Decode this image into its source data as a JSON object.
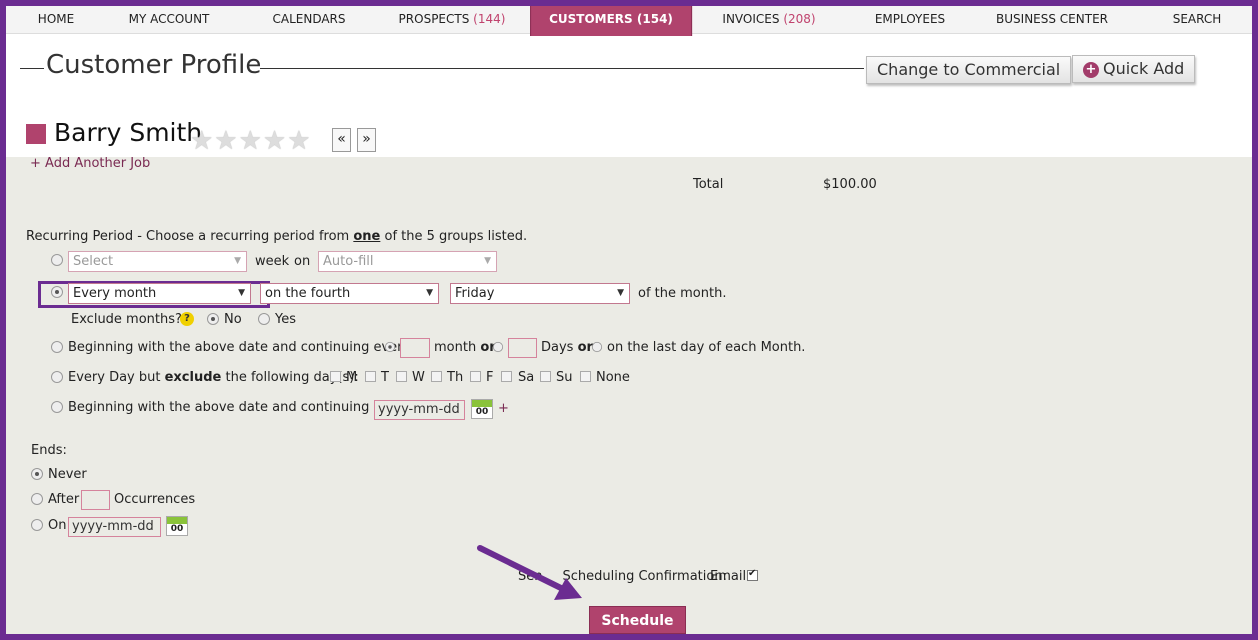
{
  "nav": {
    "home": "HOME",
    "my_account": "MY ACCOUNT",
    "calendars": "CALENDARS",
    "prospects": "PROSPECTS",
    "prospects_count": "(144)",
    "customers": "CUSTOMERS",
    "customers_count": "(154)",
    "invoices": "INVOICES",
    "invoices_count": "(208)",
    "employees": "EMPLOYEES",
    "business_center": "BUSINESS CENTER",
    "search": "SEARCH"
  },
  "header": {
    "title": "Customer Profile",
    "change_commercial": "Change to Commercial",
    "quick_add": "Quick Add"
  },
  "customer": {
    "name": "Barry Smith",
    "rating_stars": "★★★★★",
    "prev": "«",
    "next": "»"
  },
  "job": {
    "add_job": "+ Add Another Job",
    "total_label": "Total",
    "total_value": "$100.00"
  },
  "recurring": {
    "heading_bold": "Recurring Period",
    "heading_rest_a": " - Choose a recurring period from ",
    "heading_one": "one",
    "heading_rest_b": " of the 5 groups listed.",
    "row1": {
      "select": "Select",
      "week": "week",
      "on": "on",
      "autofill": "Auto-fill"
    },
    "row2": {
      "period": "Every month",
      "occurrence": "on the fourth",
      "day": "Friday",
      "suffix": "of the month."
    },
    "exclude": {
      "label": "Exclude months?",
      "help": "?",
      "no": "No",
      "yes": "Yes"
    },
    "row3": {
      "prefix": "Beginning with the above date and continuing every",
      "month": "month",
      "or1": "or",
      "days": "Days",
      "or2": "or",
      "last_day": "on the last day of each Month."
    },
    "row4": {
      "prefix_a": "Every Day but ",
      "exclude": "exclude",
      "prefix_b": " the following day(s):",
      "days": [
        "M",
        "T",
        "W",
        "Th",
        "F",
        "Sa",
        "Su",
        "None"
      ]
    },
    "row5": {
      "prefix": "Beginning with the above date and continuing on:",
      "date_placeholder": "yyyy-mm-dd",
      "plus": "+"
    },
    "cal_text": "00"
  },
  "ends": {
    "label": "Ends:",
    "never": "Never",
    "after": "After",
    "occurrences": "Occurrences",
    "on": "On",
    "date_placeholder": "yyyy-mm-dd"
  },
  "footer": {
    "confirm_label_a": "Sen",
    "confirm_label_b": "Scheduling Confirmation:",
    "email": "Email",
    "schedule": "Schedule"
  },
  "colors": {
    "accent": "#b0436d",
    "frame": "#6b2c91",
    "panel": "#ebebe5"
  }
}
